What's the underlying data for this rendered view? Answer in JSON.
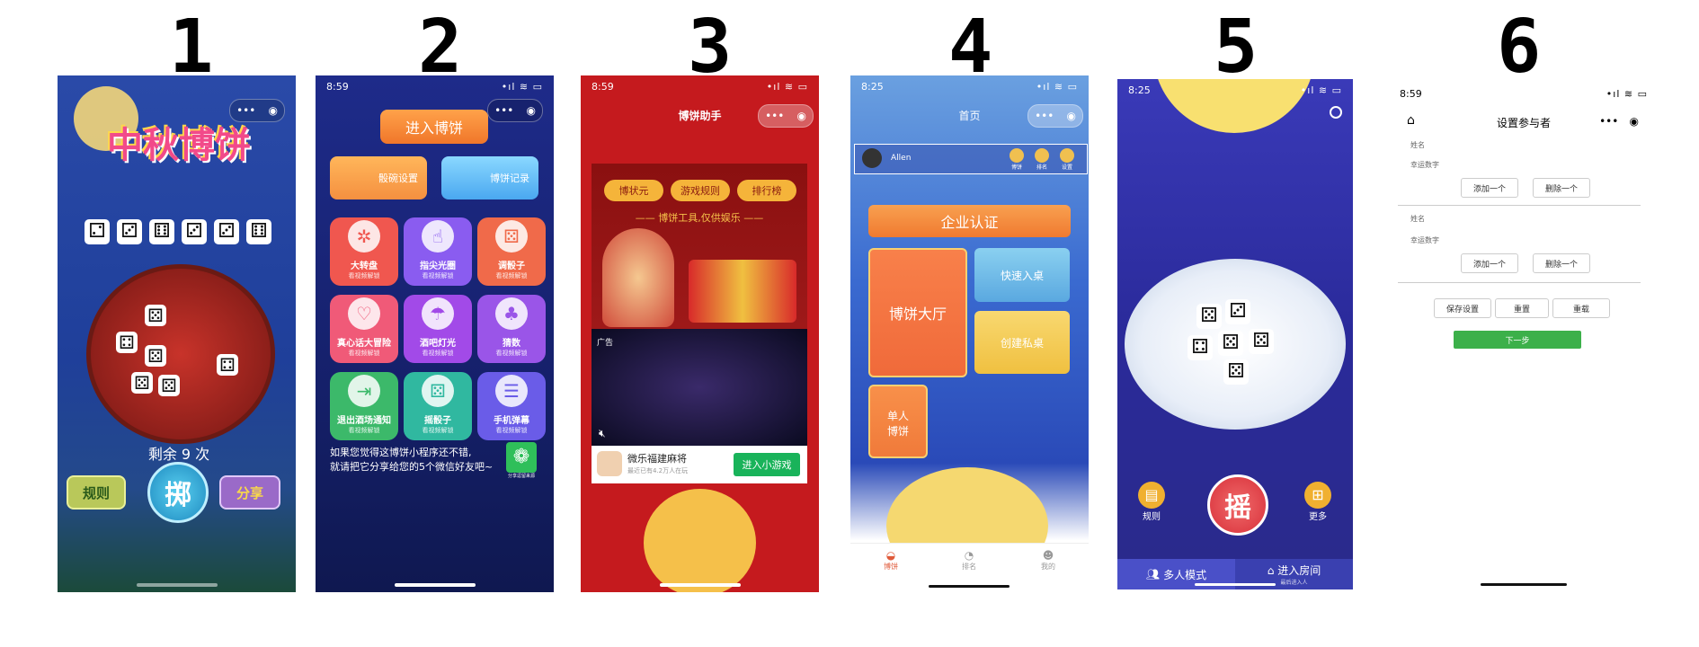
{
  "labels": [
    "1",
    "2",
    "3",
    "4",
    "5",
    "6"
  ],
  "common": {
    "time_a": "8:59",
    "time_b": "8:25",
    "signal": "•ıl ≋ ▭"
  },
  "p1": {
    "logo": "中秋博饼",
    "dice_faces": [
      "⚁",
      "⚂",
      "⚅",
      "⚂",
      "⚂",
      "⚅"
    ],
    "remaining": "剩余 9 次",
    "rules_btn": "规则",
    "throw_btn": "掷",
    "share_btn": "分享"
  },
  "p2": {
    "enter_btn": "进入博饼",
    "settings_btn": "骰碗设置",
    "records_btn": "博饼记录",
    "tiles": [
      {
        "title": "大转盘",
        "sub": "看视频解锁",
        "icon": "✲",
        "color": "#f0574f"
      },
      {
        "title": "指尖光圈",
        "sub": "看视频解锁",
        "icon": "☝",
        "color": "#8a5cf0"
      },
      {
        "title": "调骰子",
        "sub": "看视频解锁",
        "icon": "⚄",
        "color": "#f06a4a"
      },
      {
        "title": "真心话大冒险",
        "sub": "看视频解锁",
        "icon": "♡",
        "color": "#f05a78"
      },
      {
        "title": "酒吧灯光",
        "sub": "看视频解锁",
        "icon": "☂",
        "color": "#a24ae8"
      },
      {
        "title": "猜数",
        "sub": "看视频解锁",
        "icon": "♣",
        "color": "#9a55e8"
      },
      {
        "title": "退出酒场通知",
        "sub": "看视频解锁",
        "icon": "⇥",
        "color": "#3cb96a"
      },
      {
        "title": "摇骰子",
        "sub": "看视频解锁",
        "icon": "⚄",
        "color": "#30b8a0"
      },
      {
        "title": "手机弹幕",
        "sub": "看视频解锁",
        "icon": "☰",
        "color": "#6a5ce8"
      }
    ],
    "share_text_1": "如果您觉得这博饼小程序还不错,",
    "share_text_2": "就请把它分享给您的5个微信好友吧~",
    "share_icon_caption": "分享逗留来源"
  },
  "p3": {
    "title": "博饼助手",
    "tab1": "博状元",
    "tab2": "游戏规则",
    "tab3": "排行榜",
    "slogan": "—— 博饼工具,仅供娱乐 ——",
    "ad_tag": "广告",
    "game_name": "微乐福建麻将",
    "game_sub": "最近已有4.2万人在玩",
    "play_btn": "进入小游戏"
  },
  "p4": {
    "title": "首页",
    "user": "Allen",
    "mini_icons": [
      "博饼",
      "排名",
      "设置"
    ],
    "cert_btn": "企业认证",
    "hall": "博饼大厅",
    "quick": "快速入桌",
    "create": "创建私桌",
    "single_1": "单人",
    "single_2": "博饼",
    "tabs": [
      "博饼",
      "排名",
      "我的"
    ]
  },
  "p5": {
    "rules": "规则",
    "shake": "摇",
    "more": "更多",
    "multi": "多人模式",
    "room": "进入房间",
    "room_sub": "最后进入人"
  },
  "p6": {
    "title": "设置参与者",
    "name_label": "姓名",
    "lucky_label": "幸运数字",
    "add": "添加一个",
    "del": "删除一个",
    "save": "保存设置",
    "reset": "重置",
    "reload": "重载",
    "next": "下一步"
  }
}
